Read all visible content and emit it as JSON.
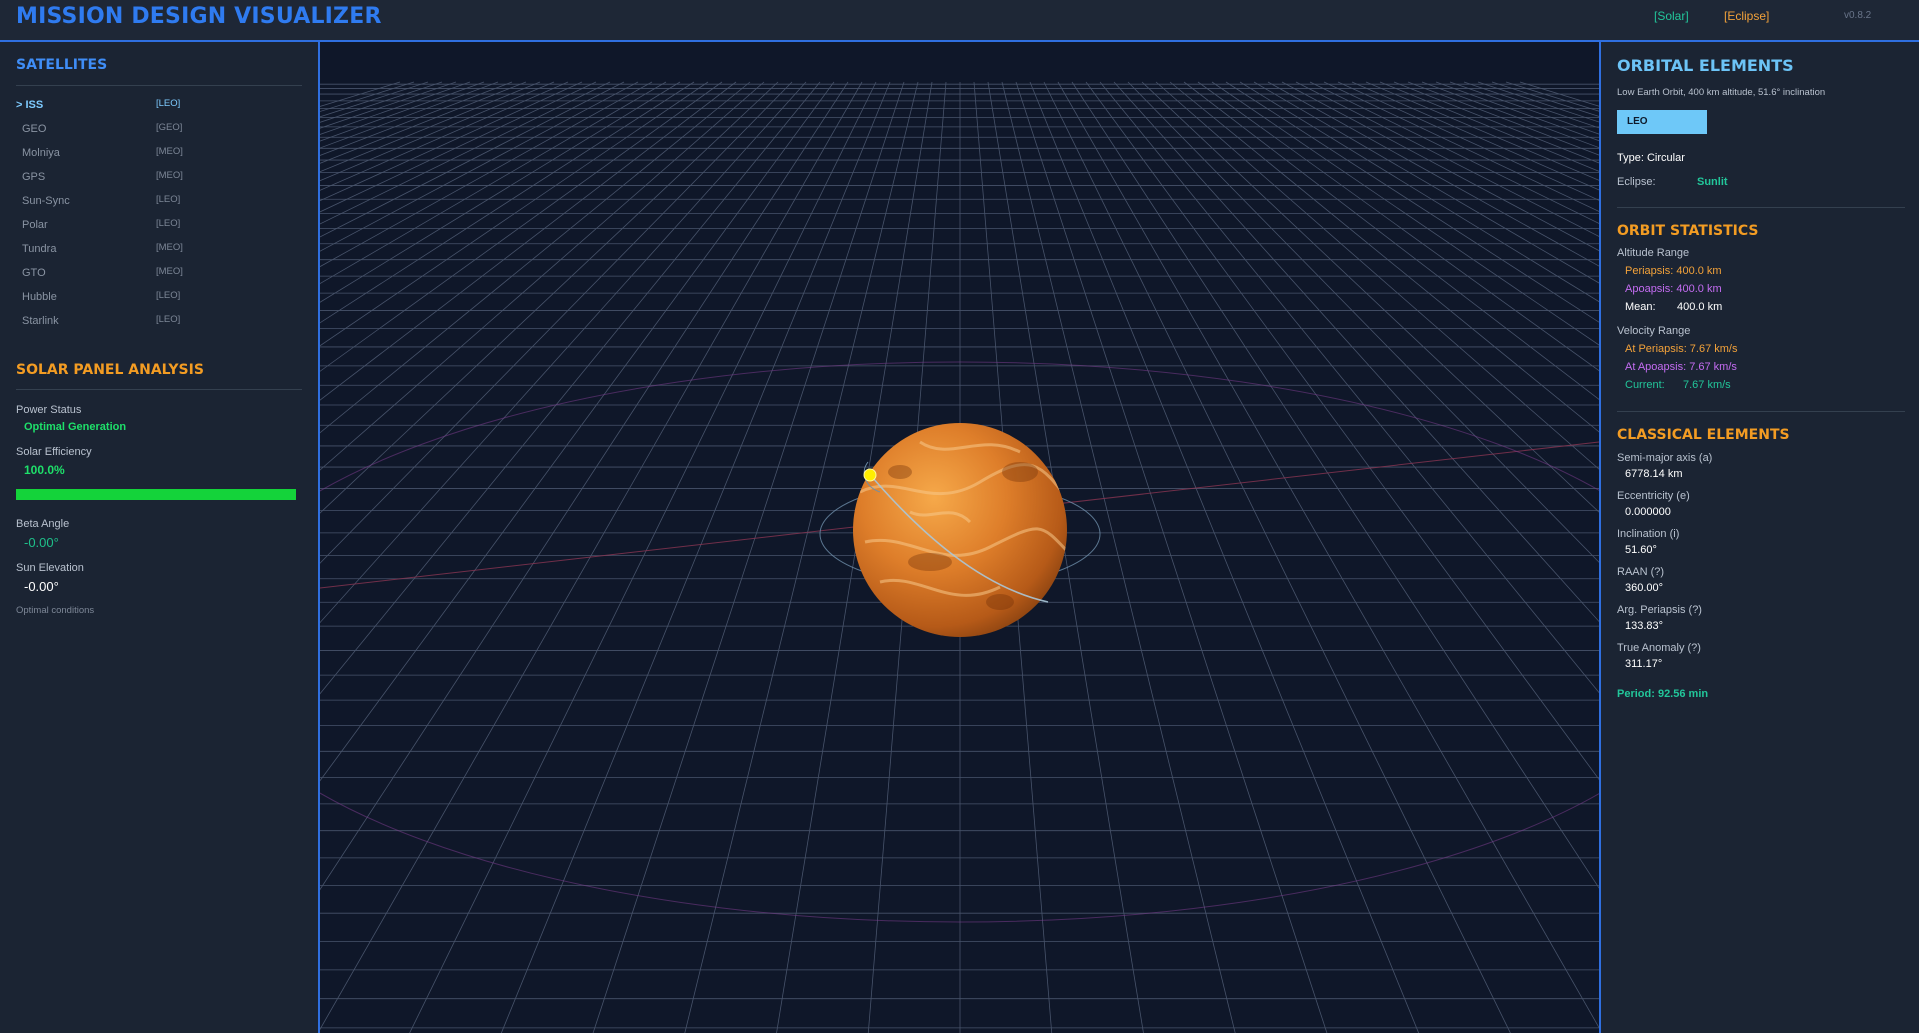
{
  "header": {
    "title": "MISSION DESIGN VISUALIZER",
    "solar_button": "[Solar]",
    "eclipse_button": "[Eclipse]",
    "version": "v0.8.2"
  },
  "satellites": {
    "title": "SATELLITES",
    "selected_prefix": "> ",
    "items": [
      {
        "name": "ISS",
        "orbit": "[LEO]",
        "selected": true
      },
      {
        "name": "GEO",
        "orbit": "[GEO]",
        "selected": false
      },
      {
        "name": "Molniya",
        "orbit": "[MEO]",
        "selected": false
      },
      {
        "name": "GPS",
        "orbit": "[MEO]",
        "selected": false
      },
      {
        "name": "Sun-Sync",
        "orbit": "[LEO]",
        "selected": false
      },
      {
        "name": "Polar",
        "orbit": "[LEO]",
        "selected": false
      },
      {
        "name": "Tundra",
        "orbit": "[MEO]",
        "selected": false
      },
      {
        "name": "GTO",
        "orbit": "[MEO]",
        "selected": false
      },
      {
        "name": "Hubble",
        "orbit": "[LEO]",
        "selected": false
      },
      {
        "name": "Starlink",
        "orbit": "[LEO]",
        "selected": false
      }
    ]
  },
  "solar_panel": {
    "title": "SOLAR PANEL ANALYSIS",
    "power_status_label": "Power Status",
    "power_status_value": "Optimal Generation",
    "efficiency_label": "Solar Efficiency",
    "efficiency_value": "100.0%",
    "efficiency_fraction": 1.0,
    "beta_label": "Beta Angle",
    "beta_value": "-0.00°",
    "sun_elevation_label": "Sun Elevation",
    "sun_elevation_value": "-0.00°",
    "note": "Optimal conditions"
  },
  "orbital_elements": {
    "title": "ORBITAL ELEMENTS",
    "description": "Low Earth Orbit, 400 km altitude, 51.6° inclination",
    "badge": "LEO",
    "type_line": "Type: Circular",
    "eclipse_label": "Eclipse:",
    "eclipse_value": "Sunlit"
  },
  "orbit_statistics": {
    "title": "ORBIT STATISTICS",
    "altitude_label": "Altitude Range",
    "periapsis": "Periapsis:  400.0 km",
    "apoapsis": "Apoapsis:  400.0 km",
    "mean_label": "Mean:",
    "mean_value": "400.0 km",
    "velocity_label": "Velocity Range",
    "v_periapsis": "At Periapsis:  7.67 km/s",
    "v_apoapsis": "At Apoapsis:  7.67 km/s",
    "current_label": "Current:",
    "current_value": "7.67 km/s"
  },
  "classical_elements": {
    "title": "CLASSICAL ELEMENTS",
    "items": [
      {
        "label": "Semi-major axis (a)",
        "value": "6778.14 km"
      },
      {
        "label": "Eccentricity (e)",
        "value": "0.000000"
      },
      {
        "label": "Inclination (i)",
        "value": "51.60°"
      },
      {
        "label": "RAAN (?)",
        "value": "360.00°"
      },
      {
        "label": "Arg. Periapsis (?)",
        "value": "133.83°"
      },
      {
        "label": "True Anomaly (?)",
        "value": "311.17°"
      }
    ],
    "period": "Period: 92.56 min"
  },
  "colors": {
    "accent_blue": "#2f6fe0",
    "title_orange": "#f39c23",
    "status_green": "#1ee06a",
    "planet_orange": "#d9782a",
    "satellite_yellow": "#ffee00"
  }
}
